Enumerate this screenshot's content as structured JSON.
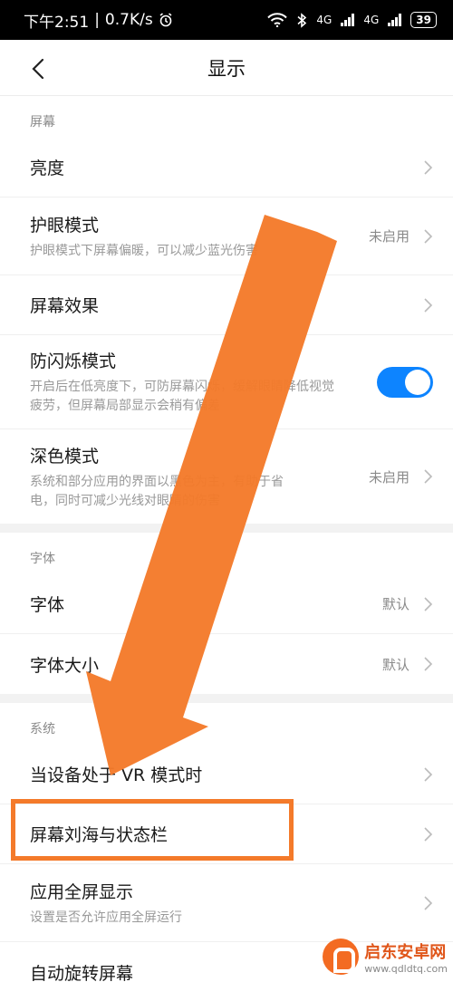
{
  "status_bar": {
    "time": "下午2:51",
    "separator": "|",
    "net_speed": "0.7K/s",
    "network_label_1": "4G",
    "network_label_2": "4G",
    "battery": "39"
  },
  "header": {
    "title": "显示"
  },
  "sections": {
    "screen": {
      "header": "屏幕",
      "brightness": {
        "title": "亮度"
      },
      "eye_care": {
        "title": "护眼模式",
        "subtitle": "护眼模式下屏幕偏暖，可以减少蓝光伤害",
        "value": "未启用"
      },
      "screen_effect": {
        "title": "屏幕效果"
      },
      "anti_flicker": {
        "title": "防闪烁模式",
        "subtitle_1": "开启后在低亮度下，可防屏幕闪烁，缓解眼睛降低视觉",
        "subtitle_2": "疲劳，但屏幕局部显示会稍有偏差",
        "enabled": true
      },
      "dark_mode": {
        "title": "深色模式",
        "subtitle_1": "系统和部分应用的界面以黑色为主，有助于省",
        "subtitle_2": "电，同时可减少光线对眼睛的伤害",
        "value": "未启用"
      }
    },
    "font": {
      "header": "字体",
      "font": {
        "title": "字体",
        "value": "默认"
      },
      "font_size": {
        "title": "字体大小",
        "value": "默认"
      }
    },
    "system": {
      "header": "系统",
      "vr_mode": {
        "title": "当设备处于 VR 模式时"
      },
      "notch_status_bar": {
        "title": "屏幕刘海与状态栏"
      },
      "fullscreen_apps": {
        "title": "应用全屏显示",
        "subtitle": "设置是否允许应用全屏运行"
      },
      "auto_rotate": {
        "title": "自动旋转屏幕"
      }
    }
  },
  "watermark": {
    "name": "启东安卓网",
    "url": "www.qdldtq.com"
  },
  "colors": {
    "accent": "#0d84ff",
    "annotation": "#f47a2a"
  }
}
